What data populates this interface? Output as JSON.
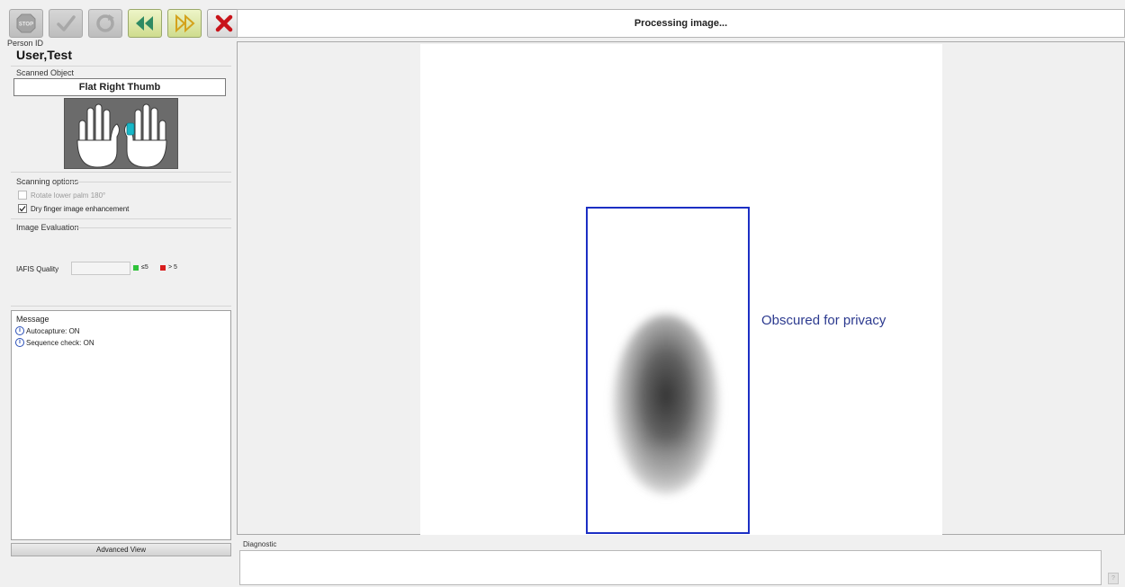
{
  "toolbar": {
    "buttons": [
      {
        "name": "stop-icon",
        "label": "STOP",
        "enabled": false
      },
      {
        "name": "checkmark-icon",
        "enabled": false
      },
      {
        "name": "refresh-icon",
        "enabled": false
      },
      {
        "name": "rewind-icon",
        "enabled": true
      },
      {
        "name": "fast-forward-icon",
        "enabled": true
      },
      {
        "name": "close-x-icon",
        "enabled": true
      }
    ]
  },
  "person": {
    "label": "Person ID",
    "name": "User,Test"
  },
  "scanned_object": {
    "label": "Scanned Object",
    "value": "Flat Right Thumb",
    "highlight_color": "#18b8c8"
  },
  "scanning_options": {
    "label": "Scanning options",
    "rotate_label": "Rotate lower palm 180°",
    "rotate_checked": false,
    "rotate_enabled": false,
    "dry_label": "Dry finger image enhancement",
    "dry_checked": true
  },
  "image_evaluation": {
    "label": "Image Evaluation",
    "iafis_label": "IAFIS Quality",
    "iafis_value": "",
    "legend_good": "≤5",
    "legend_bad": "> 5",
    "good_color": "#2fc23a",
    "bad_color": "#d81e1e"
  },
  "messages": {
    "title": "Message",
    "items": [
      "Autocapture: ON",
      "Sequence check: ON"
    ]
  },
  "advanced_view_label": "Advanced View",
  "status_text": "Processing image...",
  "privacy_note": "Obscured for privacy",
  "capture_frame_color": "#1c2fc4",
  "diagnostic": {
    "label": "Diagnostic",
    "text": "",
    "button_label": "?"
  }
}
